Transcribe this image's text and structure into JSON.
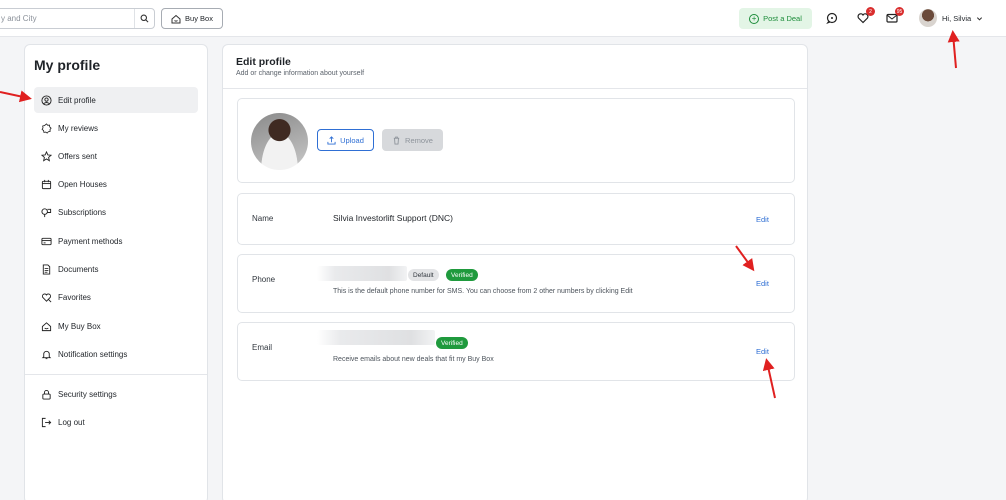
{
  "topbar": {
    "search_placeholder": "y and City",
    "buy_box_label": "Buy Box",
    "post_deal_label": "Post a Deal",
    "favorites_badge": "2",
    "inbox_badge": "95",
    "greeting": "Hi, Silvia"
  },
  "sidebar": {
    "title": "My profile",
    "items": [
      {
        "label": "Edit profile"
      },
      {
        "label": "My reviews"
      },
      {
        "label": "Offers sent"
      },
      {
        "label": "Open Houses"
      },
      {
        "label": "Subscriptions"
      },
      {
        "label": "Payment methods"
      },
      {
        "label": "Documents"
      },
      {
        "label": "Favorites"
      },
      {
        "label": "My Buy Box"
      },
      {
        "label": "Notification settings"
      },
      {
        "label": "Security settings"
      },
      {
        "label": "Log out"
      }
    ]
  },
  "main": {
    "title": "Edit profile",
    "subtitle": "Add or change information about yourself",
    "photo": {
      "upload_label": "Upload",
      "remove_label": "Remove"
    },
    "name": {
      "label": "Name",
      "value": "Silvia Investorlift Support (DNC)",
      "edit_label": "Edit"
    },
    "phone": {
      "label": "Phone",
      "default_tag": "Default",
      "verified_tag": "Verified",
      "hint": "This is the default phone number for SMS. You can choose from 2 other numbers by clicking Edit",
      "edit_label": "Edit"
    },
    "email": {
      "label": "Email",
      "verified_tag": "Verified",
      "hint": "Receive emails about new deals that fit my Buy Box",
      "edit_label": "Edit"
    }
  },
  "colors": {
    "accent": "#2f6fd4",
    "verified": "#1f9a3d",
    "post_deal_bg": "#e3f5e6",
    "badge": "#d92d2d",
    "annotation_arrow": "#e02020"
  }
}
